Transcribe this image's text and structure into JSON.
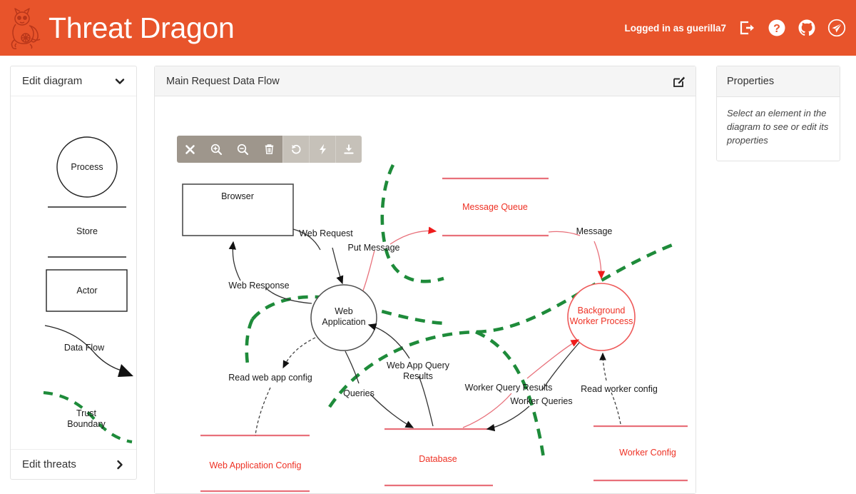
{
  "header": {
    "brand_title": "Threat Dragon",
    "logo_icon": "dragon-logo",
    "login_status": "Logged in as guerilla7",
    "icons": [
      {
        "name": "sign-out-icon",
        "label": "Sign out"
      },
      {
        "name": "help-question-icon",
        "label": "Help"
      },
      {
        "name": "github-icon",
        "label": "GitHub"
      },
      {
        "name": "paper-plane-icon",
        "label": "Send"
      }
    ],
    "accent_color": "#e8542b"
  },
  "sidebar": {
    "edit_diagram_label": "Edit diagram",
    "edit_diagram_chevron": "chevron-down-icon",
    "edit_threats_label": "Edit threats",
    "edit_threats_chevron": "chevron-right-icon",
    "stencil": [
      {
        "name": "process",
        "label": "Process",
        "shape": "circle"
      },
      {
        "name": "store",
        "label": "Store",
        "shape": "two-lines"
      },
      {
        "name": "actor",
        "label": "Actor",
        "shape": "rectangle"
      },
      {
        "name": "data-flow",
        "label": "Data Flow",
        "shape": "curved-arrow"
      },
      {
        "name": "trust-boundary",
        "label_line1": "Trust",
        "label_line2": "Boundary",
        "shape": "green-dashed-curve",
        "color": "#1e8b3a"
      }
    ]
  },
  "diagram": {
    "title": "Main Request Data Flow",
    "edit_icon": "edit-square-icon",
    "toolbar": [
      {
        "name": "close-button",
        "icon": "close-icon",
        "tone": "dark"
      },
      {
        "name": "zoom-in-button",
        "icon": "zoom-in-icon",
        "tone": "dark"
      },
      {
        "name": "zoom-out-button",
        "icon": "zoom-out-icon",
        "tone": "dark"
      },
      {
        "name": "delete-button",
        "icon": "trash-icon",
        "tone": "dark"
      },
      {
        "name": "undo-button",
        "icon": "undo-icon",
        "tone": "light"
      },
      {
        "name": "flash-button",
        "icon": "lightning-icon",
        "tone": "light"
      },
      {
        "name": "save-button",
        "icon": "download-icon",
        "tone": "light"
      }
    ],
    "nodes": [
      {
        "id": "browser",
        "type": "actor",
        "label": "Browser",
        "color": "#4d4d4d"
      },
      {
        "id": "web-application",
        "type": "process",
        "label_line1": "Web",
        "label_line2": "Application",
        "color": "#4d4d4d"
      },
      {
        "id": "background-worker-process",
        "type": "process",
        "label_line1": "Background",
        "label_line2": "Worker Process",
        "color": "#ee3124"
      },
      {
        "id": "message-queue",
        "type": "store",
        "label": "Message Queue",
        "color": "#ee3124"
      },
      {
        "id": "web-application-config",
        "type": "store",
        "label": "Web Application Config",
        "color": "#ee3124"
      },
      {
        "id": "database",
        "type": "store",
        "label": "Database",
        "color": "#ee3124"
      },
      {
        "id": "worker-config",
        "type": "store",
        "label": "Worker Config",
        "color": "#ee3124"
      }
    ],
    "flows": [
      {
        "id": "web-request",
        "label": "Web Request",
        "style": "solid",
        "color": "#333333"
      },
      {
        "id": "web-response",
        "label": "Web Response",
        "style": "solid",
        "color": "#333333"
      },
      {
        "id": "put-message",
        "label": "Put Message",
        "style": "solid",
        "color": "#ee3124"
      },
      {
        "id": "message",
        "label": "Message",
        "style": "solid",
        "color": "#ee3124"
      },
      {
        "id": "read-web-app-config",
        "label": "Read web app config",
        "style": "dashed",
        "color": "#333333"
      },
      {
        "id": "queries",
        "label": "Queries",
        "style": "solid",
        "color": "#333333"
      },
      {
        "id": "web-app-query-results",
        "label_line1": "Web App Query",
        "label_line2": "Results",
        "style": "solid",
        "color": "#333333"
      },
      {
        "id": "worker-query-results",
        "label": "Worker Query Results",
        "style": "solid",
        "color": "#ee3124"
      },
      {
        "id": "worker-queries",
        "label": "Worker Queries",
        "style": "solid",
        "color": "#333333"
      },
      {
        "id": "read-worker-config",
        "label": "Read worker config",
        "style": "dashed",
        "color": "#333333"
      }
    ],
    "trust_boundaries": [
      {
        "id": "boundary-left",
        "color": "#1e8b3a"
      },
      {
        "id": "boundary-right",
        "color": "#1e8b3a"
      }
    ]
  },
  "properties": {
    "title": "Properties",
    "empty_message": "Select an element in the diagram to see or edit its properties"
  }
}
